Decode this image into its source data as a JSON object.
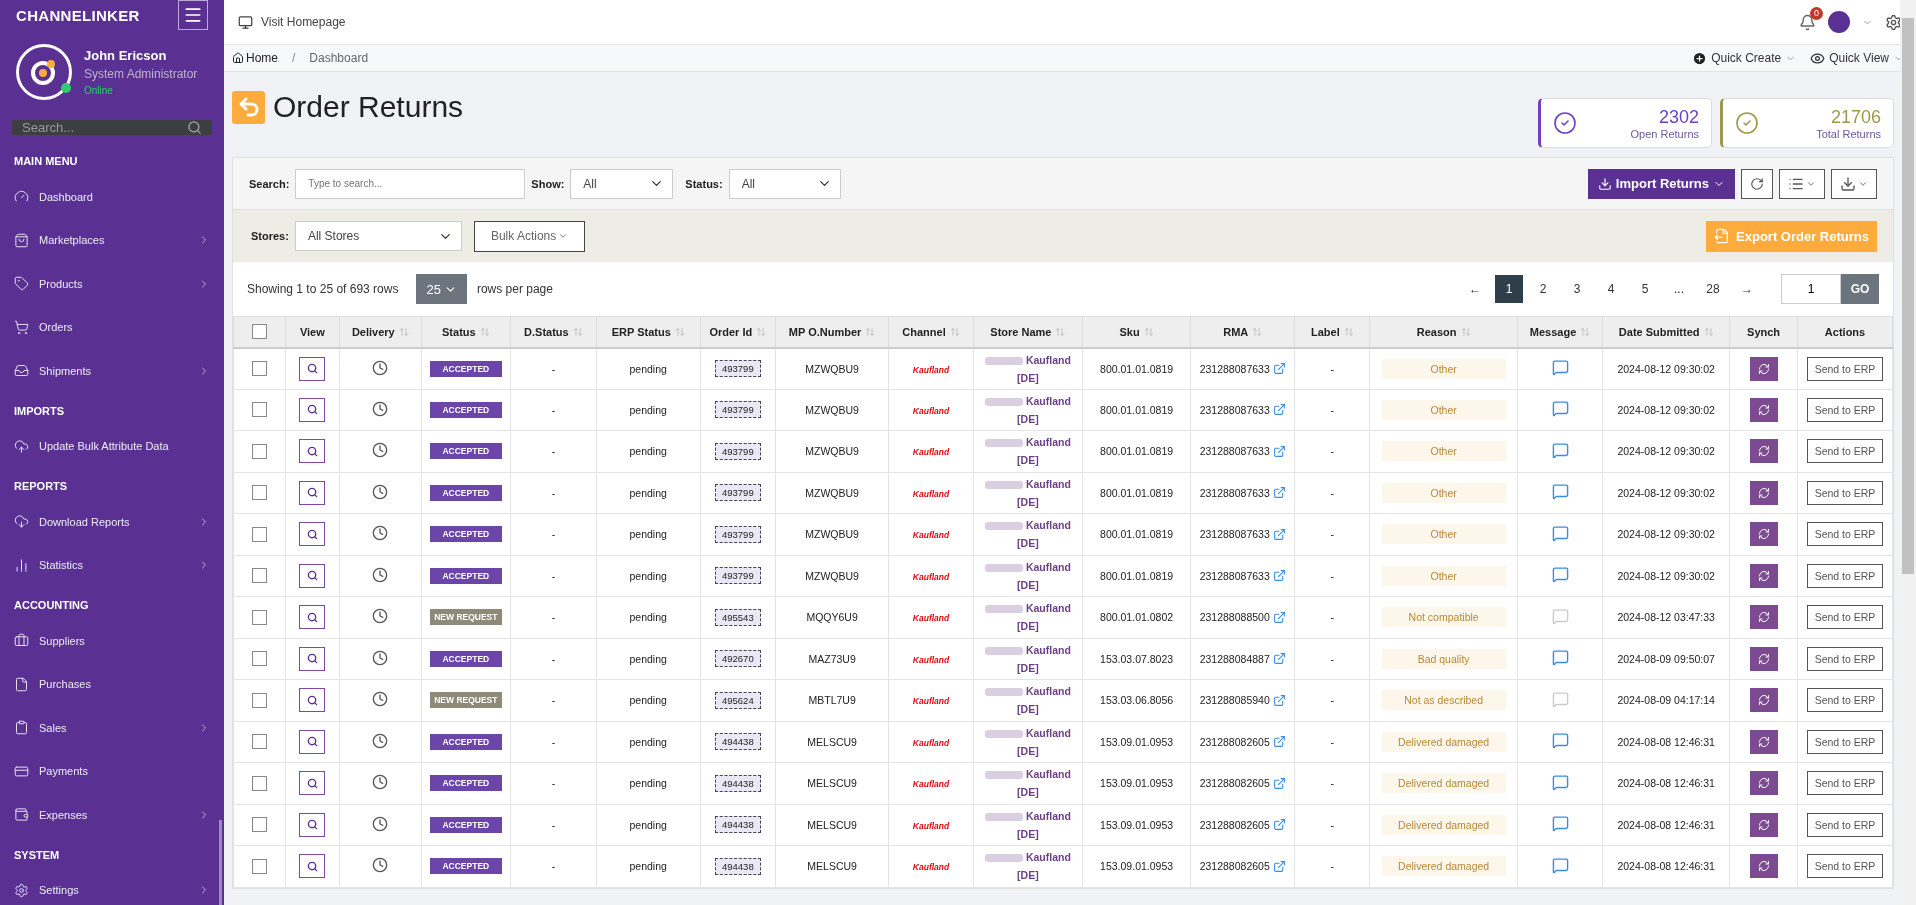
{
  "sidebar": {
    "brand": "CHANNELINKER",
    "user": {
      "name": "John Ericson",
      "role": "System Administrator",
      "status": "Online"
    },
    "search": {
      "placeholder": "Search..."
    },
    "sections": [
      {
        "title": "MAIN MENU",
        "items": [
          {
            "label": "Dashboard",
            "has_children": false
          },
          {
            "label": "Marketplaces",
            "has_children": true
          },
          {
            "label": "Products",
            "has_children": true
          },
          {
            "label": "Orders",
            "has_children": false
          },
          {
            "label": "Shipments",
            "has_children": true
          }
        ]
      },
      {
        "title": "IMPORTS",
        "items": [
          {
            "label": "Update Bulk Attribute Data",
            "has_children": false
          }
        ]
      },
      {
        "title": "REPORTS",
        "items": [
          {
            "label": "Download Reports",
            "has_children": true
          },
          {
            "label": "Statistics",
            "has_children": true
          }
        ]
      },
      {
        "title": "ACCOUNTING",
        "items": [
          {
            "label": "Suppliers",
            "has_children": false
          },
          {
            "label": "Purchases",
            "has_children": false
          },
          {
            "label": "Sales",
            "has_children": true
          },
          {
            "label": "Payments",
            "has_children": false
          },
          {
            "label": "Expenses",
            "has_children": true
          }
        ]
      },
      {
        "title": "SYSTEM",
        "items": [
          {
            "label": "Settings",
            "has_children": true
          }
        ]
      }
    ]
  },
  "topbar": {
    "link": "Visit Homepage",
    "notifications": "0"
  },
  "breadcrumb": [
    "Home",
    "Dashboard"
  ],
  "breadcrumb_separator": "/",
  "quick_actions": [
    "Quick Create",
    "Quick View"
  ],
  "page_title": "Order Returns",
  "stats": [
    {
      "value": "2302",
      "label": "Open Returns",
      "color": "#6f42c1"
    },
    {
      "value": "21706",
      "label": "Total Returns",
      "color": "#9a9a4a"
    }
  ],
  "filters": {
    "search": {
      "label": "Search:",
      "placeholder": "Type to search..."
    },
    "show": {
      "label": "Show:",
      "value": "All"
    },
    "status": {
      "label": "Status:",
      "value": "All"
    },
    "stores": {
      "label": "Stores:",
      "value": "All Stores"
    },
    "bulk": "Bulk Actions",
    "import": "Import Returns",
    "export": "Export Order Returns"
  },
  "paging": {
    "summary": "Showing 1 to 25 of 693 rows",
    "per_page": "25",
    "per_page_label": "rows per page",
    "pages": [
      {
        "label": "1",
        "selected": true
      },
      {
        "label": "2",
        "selected": false
      },
      {
        "label": "3",
        "selected": false
      },
      {
        "label": "4",
        "selected": false
      },
      {
        "label": "5",
        "selected": false
      },
      {
        "label": "...",
        "selected": false
      },
      {
        "label": "28",
        "selected": false
      }
    ],
    "prev": "←",
    "next": "→",
    "goto": "1",
    "go": "GO"
  },
  "table": {
    "select_all": {
      "checked": false
    },
    "columns": [
      {
        "sortable": false
      },
      {
        "label": "View",
        "sortable": false
      },
      {
        "label": "Delivery",
        "sortable": true
      },
      {
        "label": "Status",
        "sortable": true
      },
      {
        "label": "D.Status",
        "sortable": true
      },
      {
        "label": "ERP Status",
        "sortable": true
      },
      {
        "label": "Order Id",
        "sortable": true
      },
      {
        "label": "MP O.Number",
        "sortable": true
      },
      {
        "label": "Channel",
        "sortable": true
      },
      {
        "label": "Store Name",
        "sortable": true
      },
      {
        "label": "Sku",
        "sortable": true
      },
      {
        "label": "RMA",
        "sortable": true
      },
      {
        "label": "Label",
        "sortable": true
      },
      {
        "label": "Reason",
        "sortable": true
      },
      {
        "label": "Message",
        "sortable": true
      },
      {
        "label": "Date Submitted",
        "sortable": true
      },
      {
        "label": "Synch",
        "sortable": false
      },
      {
        "label": "Actions",
        "sortable": false
      }
    ],
    "rows": [
      {
        "checked": false,
        "status": "ACCEPTED",
        "kind": "accepted",
        "d_status": "-",
        "erp": "pending",
        "order_id": "493799",
        "mp": "MZWQBU9",
        "channel": "Kaufland",
        "store": "Kaufland",
        "store_region": "[DE]",
        "sku": "800.01.01.0819",
        "rma": "231288087633",
        "label": "-",
        "reason": "Other",
        "has_message": true,
        "date": "2024-08-12 09:30:02",
        "action": "Send to ERP"
      },
      {
        "checked": false,
        "status": "ACCEPTED",
        "kind": "accepted",
        "d_status": "-",
        "erp": "pending",
        "order_id": "493799",
        "mp": "MZWQBU9",
        "channel": "Kaufland",
        "store": "Kaufland",
        "store_region": "[DE]",
        "sku": "800.01.01.0819",
        "rma": "231288087633",
        "label": "-",
        "reason": "Other",
        "has_message": true,
        "date": "2024-08-12 09:30:02",
        "action": "Send to ERP"
      },
      {
        "checked": false,
        "status": "ACCEPTED",
        "kind": "accepted",
        "d_status": "-",
        "erp": "pending",
        "order_id": "493799",
        "mp": "MZWQBU9",
        "channel": "Kaufland",
        "store": "Kaufland",
        "store_region": "[DE]",
        "sku": "800.01.01.0819",
        "rma": "231288087633",
        "label": "-",
        "reason": "Other",
        "has_message": true,
        "date": "2024-08-12 09:30:02",
        "action": "Send to ERP"
      },
      {
        "checked": false,
        "status": "ACCEPTED",
        "kind": "accepted",
        "d_status": "-",
        "erp": "pending",
        "order_id": "493799",
        "mp": "MZWQBU9",
        "channel": "Kaufland",
        "store": "Kaufland",
        "store_region": "[DE]",
        "sku": "800.01.01.0819",
        "rma": "231288087633",
        "label": "-",
        "reason": "Other",
        "has_message": true,
        "date": "2024-08-12 09:30:02",
        "action": "Send to ERP"
      },
      {
        "checked": false,
        "status": "ACCEPTED",
        "kind": "accepted",
        "d_status": "-",
        "erp": "pending",
        "order_id": "493799",
        "mp": "MZWQBU9",
        "channel": "Kaufland",
        "store": "Kaufland",
        "store_region": "[DE]",
        "sku": "800.01.01.0819",
        "rma": "231288087633",
        "label": "-",
        "reason": "Other",
        "has_message": true,
        "date": "2024-08-12 09:30:02",
        "action": "Send to ERP"
      },
      {
        "checked": false,
        "status": "ACCEPTED",
        "kind": "accepted",
        "d_status": "-",
        "erp": "pending",
        "order_id": "493799",
        "mp": "MZWQBU9",
        "channel": "Kaufland",
        "store": "Kaufland",
        "store_region": "[DE]",
        "sku": "800.01.01.0819",
        "rma": "231288087633",
        "label": "-",
        "reason": "Other",
        "has_message": true,
        "date": "2024-08-12 09:30:02",
        "action": "Send to ERP"
      },
      {
        "checked": false,
        "status": "NEW REQUEST",
        "kind": "new",
        "d_status": "-",
        "erp": "pending",
        "order_id": "495543",
        "mp": "MQQY6U9",
        "channel": "Kaufland",
        "store": "Kaufland",
        "store_region": "[DE]",
        "sku": "800.01.01.0802",
        "rma": "231288088500",
        "label": "-",
        "reason": "Not compatible",
        "has_message": false,
        "date": "2024-08-12 03:47:33",
        "action": "Send to ERP"
      },
      {
        "checked": false,
        "status": "ACCEPTED",
        "kind": "accepted",
        "d_status": "-",
        "erp": "pending",
        "order_id": "492670",
        "mp": "MAZ73U9",
        "channel": "Kaufland",
        "store": "Kaufland",
        "store_region": "[DE]",
        "sku": "153.03.07.8023",
        "rma": "231288084887",
        "label": "-",
        "reason": "Bad quality",
        "has_message": true,
        "date": "2024-08-09 09:50:07",
        "action": "Send to ERP"
      },
      {
        "checked": false,
        "status": "NEW REQUEST",
        "kind": "new",
        "d_status": "-",
        "erp": "pending",
        "order_id": "495624",
        "mp": "MBTL7U9",
        "channel": "Kaufland",
        "store": "Kaufland",
        "store_region": "[DE]",
        "sku": "153.03.06.8056",
        "rma": "231288085940",
        "label": "-",
        "reason": "Not as described",
        "has_message": false,
        "date": "2024-08-09 04:17:14",
        "action": "Send to ERP"
      },
      {
        "checked": false,
        "status": "ACCEPTED",
        "kind": "accepted",
        "d_status": "-",
        "erp": "pending",
        "order_id": "494438",
        "mp": "MELSCU9",
        "channel": "Kaufland",
        "store": "Kaufland",
        "store_region": "[DE]",
        "sku": "153.09.01.0953",
        "rma": "231288082605",
        "label": "-",
        "reason": "Delivered damaged",
        "has_message": true,
        "date": "2024-08-08 12:46:31",
        "action": "Send to ERP"
      },
      {
        "checked": false,
        "status": "ACCEPTED",
        "kind": "accepted",
        "d_status": "-",
        "erp": "pending",
        "order_id": "494438",
        "mp": "MELSCU9",
        "channel": "Kaufland",
        "store": "Kaufland",
        "store_region": "[DE]",
        "sku": "153.09.01.0953",
        "rma": "231288082605",
        "label": "-",
        "reason": "Delivered damaged",
        "has_message": true,
        "date": "2024-08-08 12:46:31",
        "action": "Send to ERP"
      },
      {
        "checked": false,
        "status": "ACCEPTED",
        "kind": "accepted",
        "d_status": "-",
        "erp": "pending",
        "order_id": "494438",
        "mp": "MELSCU9",
        "channel": "Kaufland",
        "store": "Kaufland",
        "store_region": "[DE]",
        "sku": "153.09.01.0953",
        "rma": "231288082605",
        "label": "-",
        "reason": "Delivered damaged",
        "has_message": true,
        "date": "2024-08-08 12:46:31",
        "action": "Send to ERP"
      },
      {
        "checked": false,
        "status": "ACCEPTED",
        "kind": "accepted",
        "d_status": "-",
        "erp": "pending",
        "order_id": "494438",
        "mp": "MELSCU9",
        "channel": "Kaufland",
        "store": "Kaufland",
        "store_region": "[DE]",
        "sku": "153.09.01.0953",
        "rma": "231288082605",
        "label": "-",
        "reason": "Delivered damaged",
        "has_message": true,
        "date": "2024-08-08 12:46:31",
        "action": "Send to ERP"
      }
    ]
  }
}
